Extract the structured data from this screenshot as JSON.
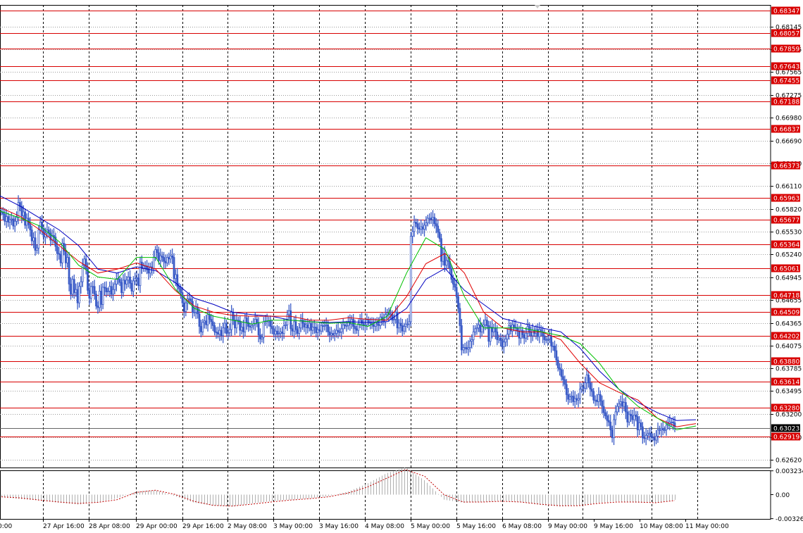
{
  "chart_data": {
    "type": "candlestick",
    "series": [
      {
        "name": "price",
        "values": [
          0.6578,
          0.6575,
          0.6566,
          0.6572,
          0.6565,
          0.6568,
          0.6569,
          0.656,
          0.6566,
          0.6571,
          0.659,
          0.6585,
          0.6573,
          0.6578,
          0.6561,
          0.657,
          0.6562,
          0.6555,
          0.6541,
          0.6545,
          0.6529,
          0.6532,
          0.6555,
          0.6565,
          0.6557,
          0.6546,
          0.6551,
          0.6555,
          0.6551,
          0.6542,
          0.6548,
          0.6546,
          0.6534,
          0.6525,
          0.6524,
          0.6513,
          0.6538,
          0.6528,
          0.6513,
          0.652,
          0.6486,
          0.6473,
          0.6492,
          0.6475,
          0.6479,
          0.6462,
          0.6483,
          0.6489,
          0.651,
          0.6518,
          0.6506,
          0.6478,
          0.6468,
          0.6483,
          0.6483,
          0.6473,
          0.6458,
          0.6456,
          0.6477,
          0.646,
          0.6482,
          0.6481,
          0.6476,
          0.6477,
          0.6483,
          0.6473,
          0.6479,
          0.6486,
          0.6493,
          0.6492,
          0.6488,
          0.6475,
          0.6491,
          0.6486,
          0.6491,
          0.6495,
          0.6487,
          0.6477,
          0.649,
          0.6493,
          0.6494,
          0.6484,
          0.6514,
          0.6506,
          0.6509,
          0.6509,
          0.6504,
          0.65,
          0.6508,
          0.6506,
          0.652,
          0.653,
          0.6526,
          0.6516,
          0.6522,
          0.652,
          0.6515,
          0.6513,
          0.652,
          0.6518,
          0.6522,
          0.652,
          0.6493,
          0.6498,
          0.6483,
          0.648,
          0.6475,
          0.6462,
          0.6451,
          0.6462,
          0.6467,
          0.6467,
          0.6464,
          0.645,
          0.645,
          0.6456,
          0.6448,
          0.6432,
          0.6425,
          0.6437,
          0.6439,
          0.6434,
          0.6447,
          0.6441,
          0.6438,
          0.6433,
          0.6425,
          0.6424,
          0.6422,
          0.6427,
          0.642,
          0.643,
          0.6436,
          0.6423,
          0.6424,
          0.6428,
          0.645,
          0.644,
          0.643,
          0.644,
          0.6439,
          0.6427,
          0.6431,
          0.6425,
          0.6443,
          0.6437,
          0.6432,
          0.6431,
          0.6433,
          0.6435,
          0.6441,
          0.6437,
          0.6421,
          0.6416,
          0.6418,
          0.6438,
          0.6439,
          0.6438,
          0.6439,
          0.6432,
          0.6429,
          0.6422,
          0.6426,
          0.6422,
          0.6423,
          0.6425,
          0.6423,
          0.6433,
          0.6434,
          0.6447,
          0.6452,
          0.6429,
          0.6426,
          0.6438,
          0.6428,
          0.6423,
          0.643,
          0.644,
          0.6436,
          0.6431,
          0.6434,
          0.643,
          0.6436,
          0.6427,
          0.6431,
          0.6431,
          0.6424,
          0.6428,
          0.6426,
          0.6433,
          0.6432,
          0.6433,
          0.6434,
          0.6425,
          0.6421,
          0.6423,
          0.6421,
          0.6423,
          0.6427,
          0.6425,
          0.6425,
          0.6429,
          0.6434,
          0.6433,
          0.6433,
          0.6438,
          0.6435,
          0.6441,
          0.6432,
          0.6429,
          0.6427,
          0.6435,
          0.644,
          0.6436,
          0.6433,
          0.6434,
          0.644,
          0.6437,
          0.6436,
          0.6434,
          0.6432,
          0.6437,
          0.6435,
          0.6433,
          0.6444,
          0.6441,
          0.6438,
          0.6447,
          0.6449,
          0.6447,
          0.6448,
          0.644,
          0.6441,
          0.645,
          0.643,
          0.6436,
          0.6433,
          0.6426,
          0.6432,
          0.6435,
          0.6435,
          0.6438,
          0.6547,
          0.6553,
          0.6565,
          0.6563,
          0.6557,
          0.6556,
          0.6559,
          0.6556,
          0.6561,
          0.6564,
          0.657,
          0.657,
          0.6568,
          0.6571,
          0.6563,
          0.656,
          0.6552,
          0.6544,
          0.6515,
          0.6525,
          0.651,
          0.6516,
          0.6515,
          0.6506,
          0.6492,
          0.6486,
          0.6482,
          0.647,
          0.6455,
          0.6433,
          0.6402,
          0.6405,
          0.6405,
          0.6403,
          0.6405,
          0.6413,
          0.6415,
          0.6425,
          0.6429,
          0.643,
          0.6434,
          0.6425,
          0.6432,
          0.6434,
          0.644,
          0.6433,
          0.6413,
          0.6431,
          0.6425,
          0.643,
          0.6425,
          0.6415,
          0.6417,
          0.6414,
          0.6406,
          0.6412,
          0.6416,
          0.6422,
          0.6433,
          0.6426,
          0.6434,
          0.6431,
          0.643,
          0.6426,
          0.6417,
          0.6427,
          0.6421,
          0.6417,
          0.6423,
          0.6432,
          0.6425,
          0.642,
          0.6427,
          0.6423,
          0.6428,
          0.6419,
          0.6428,
          0.6425,
          0.642,
          0.6415,
          0.6415,
          0.6416,
          0.642,
          0.6407,
          0.6407,
          0.6401,
          0.6389,
          0.6379,
          0.6377,
          0.6368,
          0.6364,
          0.6358,
          0.6345,
          0.6339,
          0.6342,
          0.6343,
          0.6336,
          0.634,
          0.6338,
          0.634,
          0.6352,
          0.6355,
          0.6353,
          0.636,
          0.637,
          0.636,
          0.6352,
          0.6349,
          0.6338,
          0.6338,
          0.6336,
          0.6345,
          0.6337,
          0.633,
          0.6322,
          0.6318,
          0.6312,
          0.631,
          0.63,
          0.629,
          0.6313,
          0.6323,
          0.633,
          0.6333,
          0.6336,
          0.633,
          0.6335,
          0.6323,
          0.631,
          0.632,
          0.6318,
          0.6313,
          0.6319,
          0.6317,
          0.63,
          0.6309,
          0.6304,
          0.629,
          0.6289,
          0.6293,
          0.6295,
          0.6296,
          0.6291,
          0.629,
          0.6287,
          0.6292,
          0.63,
          0.63,
          0.6302,
          0.63,
          0.63,
          0.6306,
          0.6308,
          0.631,
          0.631,
          0.6309,
          0.6304
        ]
      },
      {
        "name": "ma_green",
        "values": [
          0.658,
          0.657,
          0.656,
          0.654,
          0.651,
          0.6495,
          0.6492,
          0.652,
          0.652,
          0.648,
          0.6455,
          0.6445,
          0.644,
          0.6435,
          0.644,
          0.644,
          0.6438,
          0.6436,
          0.6437,
          0.6432,
          0.6445,
          0.65,
          0.6545,
          0.653,
          0.647,
          0.643,
          0.643,
          0.643,
          0.6425,
          0.642,
          0.641,
          0.6385,
          0.6352,
          0.633,
          0.6315,
          0.63,
          0.6305
        ]
      },
      {
        "name": "ma_red",
        "values": [
          0.6585,
          0.6572,
          0.6555,
          0.6535,
          0.6515,
          0.65,
          0.6505,
          0.6513,
          0.6505,
          0.6478,
          0.6458,
          0.645,
          0.6446,
          0.6445,
          0.6445,
          0.6445,
          0.644,
          0.644,
          0.6443,
          0.6441,
          0.644,
          0.647,
          0.6512,
          0.6525,
          0.65,
          0.645,
          0.643,
          0.6425,
          0.6425,
          0.6415,
          0.6385,
          0.636,
          0.6348,
          0.6338,
          0.6315,
          0.6304,
          0.6308
        ]
      },
      {
        "name": "ma_blue",
        "values": [
          0.66,
          0.6585,
          0.657,
          0.6555,
          0.6535,
          0.6505,
          0.65,
          0.6508,
          0.6503,
          0.6488,
          0.6468,
          0.646,
          0.645,
          0.6447,
          0.6445,
          0.644,
          0.6438,
          0.6437,
          0.6438,
          0.6437,
          0.6438,
          0.6455,
          0.6492,
          0.6506,
          0.6478,
          0.646,
          0.6442,
          0.6436,
          0.643,
          0.6425,
          0.6404,
          0.6375,
          0.6352,
          0.6335,
          0.6322,
          0.6312,
          0.6313
        ]
      },
      {
        "name": "osc_hist",
        "values": [
          -0.00035,
          -0.0006,
          -0.0008,
          -0.0011,
          -0.00135,
          -0.001,
          -0.0005,
          0.00045,
          0.0006,
          -0.0002,
          -0.0011,
          -0.0015,
          -0.0016,
          -0.0012,
          -0.0009,
          -0.0007,
          -0.0005,
          -0.0002,
          0.0004,
          0.0015,
          0.0029,
          0.0037,
          0.0019,
          -0.0007,
          -0.0011,
          -0.001,
          -0.0008,
          -0.001,
          -0.0014,
          -0.0016,
          -0.0015,
          -0.0011,
          -0.0009,
          -0.0011,
          -0.0011,
          -0.0007
        ]
      },
      {
        "name": "osc_signal",
        "values": [
          -0.0003,
          -0.00045,
          -0.00075,
          -0.001,
          -0.0012,
          -0.00105,
          -0.0007,
          0.0003,
          0.0006,
          5e-05,
          -0.0009,
          -0.00145,
          -0.00155,
          -0.0013,
          -0.001,
          -0.00075,
          -0.00055,
          -0.0003,
          0.0002,
          0.001,
          0.0022,
          0.0034,
          0.0025,
          0.0,
          -0.001,
          -0.001,
          -0.0009,
          -0.001,
          -0.0013,
          -0.0015,
          -0.0015,
          -0.0012,
          -0.001,
          -0.001,
          -0.0011,
          -0.0008
        ]
      }
    ],
    "x_labels": [
      "0:00",
      "27 Apr 16:00",
      "28 Apr 08:00",
      "29 Apr 00:00",
      "29 Apr 16:00",
      "2 May 08:00",
      "3 May 00:00",
      "3 May 16:00",
      "4 May 08:00",
      "5 May 00:00",
      "5 May 16:00",
      "6 May 08:00",
      "9 May 00:00",
      "9 May 16:00",
      "10 May 08:00",
      "11 May 00:00"
    ],
    "y_ticks": [
      "0.68145",
      "0.67855",
      "0.67565",
      "0.67275",
      "0.66980",
      "0.66690",
      "0.66400",
      "0.66110",
      "0.65820",
      "0.65530",
      "0.65240",
      "0.64945",
      "0.64655",
      "0.64365",
      "0.64075",
      "0.63785",
      "0.63495",
      "0.63200",
      "0.62910",
      "0.62620"
    ],
    "levels": [
      "0.68347",
      "0.68057",
      "0.67859",
      "0.67643",
      "0.67455",
      "0.67188",
      "0.66837",
      "0.66373",
      "0.65963",
      "0.65677",
      "0.65364",
      "0.65061",
      "0.64718",
      "0.64509",
      "0.64202",
      "0.63880",
      "0.63614",
      "0.63280",
      "0.62919"
    ],
    "current_price": "0.63023",
    "osc_ticks": [
      "0.003234",
      "0.00",
      "-0.003265"
    ],
    "ylim": [
      0.6252,
      0.6842
    ],
    "osc_ylim": [
      -0.0033,
      0.0033
    ],
    "colors": {
      "candle": "#3a5bc7",
      "ma_green": "#00c000",
      "ma_red": "#e00000",
      "ma_blue": "#0000c0",
      "level": "#d80000",
      "current": "#000000",
      "grid": "#000000",
      "hist": "#b0b0b0",
      "signal": "#c00000"
    }
  }
}
